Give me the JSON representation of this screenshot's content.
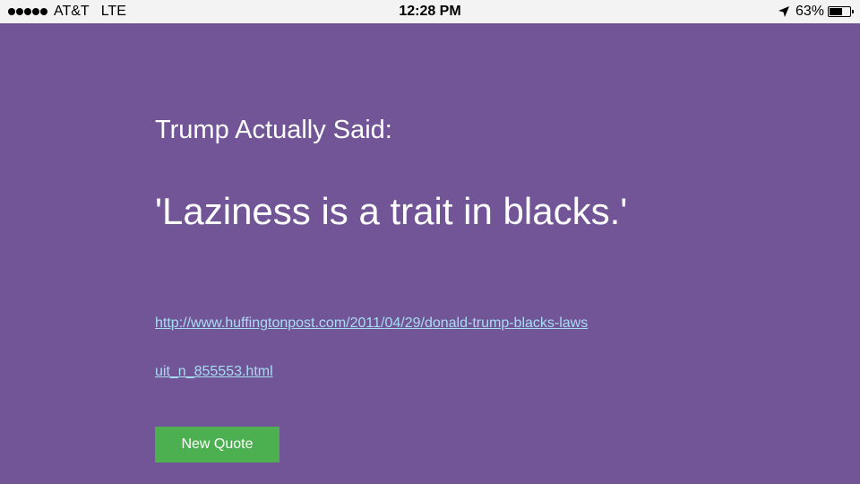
{
  "status_bar": {
    "carrier": "AT&T",
    "network": "LTE",
    "time": "12:28 PM",
    "battery_percent_label": "63%",
    "battery_level": 0.63,
    "signal_bars": 5
  },
  "main": {
    "heading": "Trump Actually Said:",
    "quote": "'Laziness is a trait in blacks.'",
    "source_url": "http://www.huffingtonpost.com/2011/04/29/donald-trump-blacks-lawsuit_n_855553.html",
    "new_quote_label": "New Quote"
  },
  "colors": {
    "background": "#715596",
    "button": "#4caf50",
    "link": "#a7ddf2",
    "status_bar": "#f3f3f3"
  }
}
